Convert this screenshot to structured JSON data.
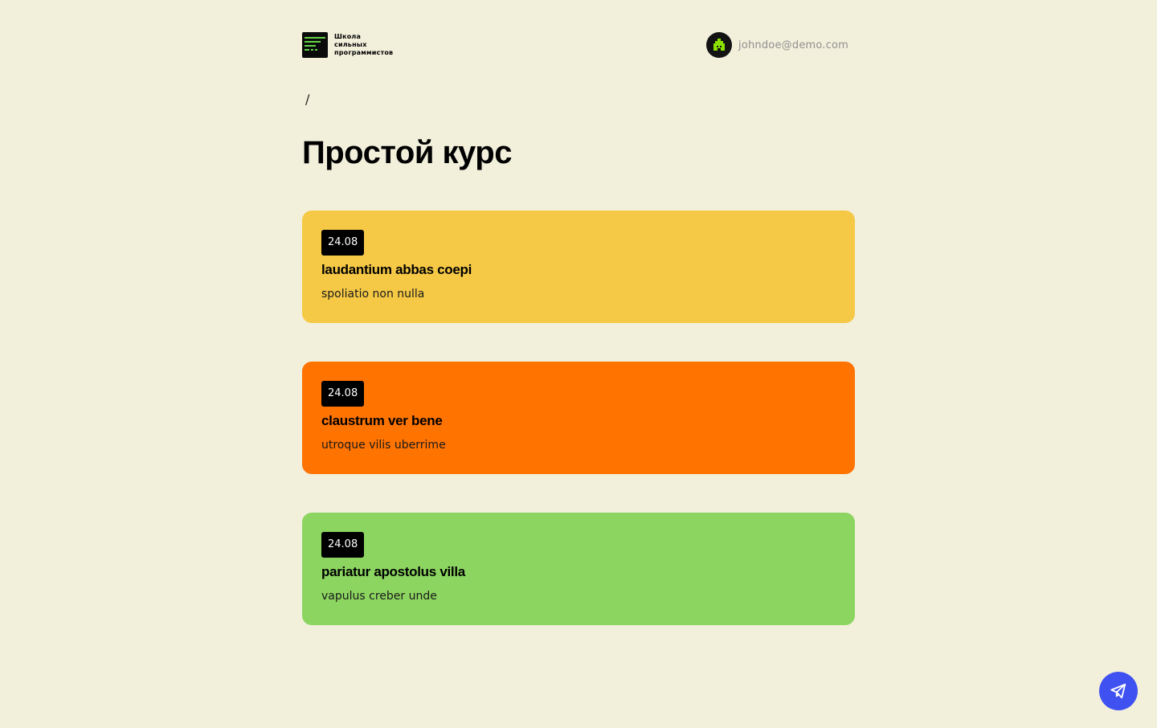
{
  "header": {
    "logo": {
      "lines": [
        "Школа",
        "сильных",
        "программистов"
      ]
    },
    "user": {
      "email": "johndoe@demo.com"
    }
  },
  "breadcrumb": {
    "separator": "/"
  },
  "page": {
    "title": "Простой курс"
  },
  "lessons": [
    {
      "date": "24.08",
      "title": "laudantium abbas coepi",
      "subtitle": "spoliatio non nulla",
      "color": "#f5c945"
    },
    {
      "date": "24.08",
      "title": "claustrum ver bene",
      "subtitle": "utroque vilis uberrime",
      "color": "#ff7300"
    },
    {
      "date": "24.08",
      "title": "pariatur apostolus villa",
      "subtitle": "vapulus creber unde",
      "color": "#8cd560"
    }
  ],
  "colors": {
    "background": "#f2efdb",
    "accent_green": "#63d245",
    "fab": "#3f51f0"
  },
  "icons": {
    "fab": "telegram-icon",
    "avatar": "house-avatar-icon"
  }
}
